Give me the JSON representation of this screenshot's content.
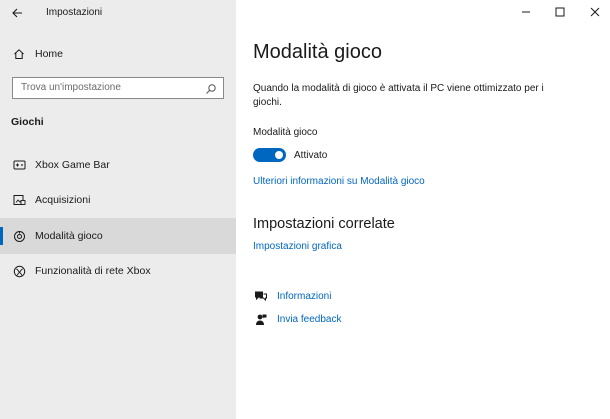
{
  "window": {
    "title": "Impostazioni",
    "controls": {
      "minimize": "minimize-icon",
      "maximize": "maximize-icon",
      "close": "close-icon"
    }
  },
  "sidebar": {
    "home_label": "Home",
    "search_placeholder": "Trova un'impostazione",
    "section_header": "Giochi",
    "items": [
      {
        "label": "Xbox Game Bar",
        "icon": "xbox-game-bar-icon",
        "selected": false
      },
      {
        "label": "Acquisizioni",
        "icon": "captures-icon",
        "selected": false
      },
      {
        "label": "Modalità gioco",
        "icon": "game-mode-icon",
        "selected": true
      },
      {
        "label": "Funzionalità di rete Xbox",
        "icon": "xbox-icon",
        "selected": false
      }
    ]
  },
  "main": {
    "title": "Modalità gioco",
    "description": "Quando la modalità di gioco è attivata il PC viene ottimizzato per i giochi.",
    "toggle": {
      "label": "Modalità gioco",
      "state_text": "Attivato",
      "on": true
    },
    "more_info_link": "Ulteriori informazioni su Modalità gioco",
    "related": {
      "header": "Impostazioni correlate",
      "link": "Impostazioni grafica"
    },
    "help": [
      {
        "label": "Informazioni",
        "icon": "get-help-icon"
      },
      {
        "label": "Invia feedback",
        "icon": "feedback-icon"
      }
    ]
  },
  "colors": {
    "accent": "#0067c0",
    "sidebar_bg": "#ececec",
    "selected_bg": "#d9d9d9"
  }
}
